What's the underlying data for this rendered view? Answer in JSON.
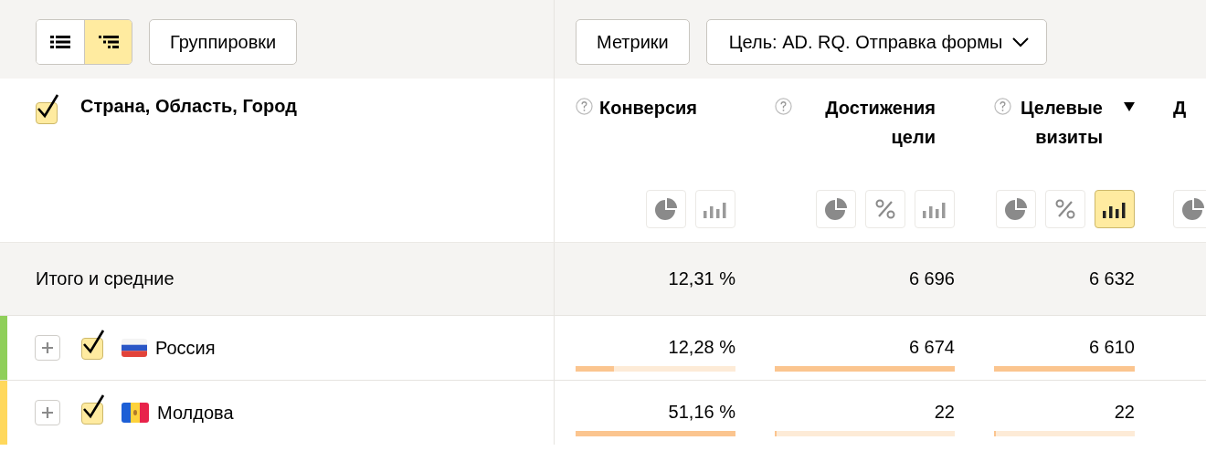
{
  "toolbar": {
    "view_modes": [
      {
        "kind": "list",
        "selected": false
      },
      {
        "kind": "tree",
        "selected": true
      }
    ],
    "groupings_button": "Группировки",
    "metrics_button": "Метрики",
    "goal_dropdown": "Цель: AD. RQ. Отправка формы"
  },
  "table": {
    "dimension_header": {
      "title": "Страна, Область, Город",
      "checked": true
    },
    "columns": [
      {
        "title": "Конверсия",
        "help": true,
        "sorted": false,
        "view_buttons": [
          {
            "kind": "pie",
            "selected": false
          },
          {
            "kind": "bars",
            "selected": false
          }
        ]
      },
      {
        "title": "Достижения цели",
        "help": true,
        "sorted": false,
        "view_buttons": [
          {
            "kind": "pie",
            "selected": false
          },
          {
            "kind": "percent",
            "selected": false
          },
          {
            "kind": "bars",
            "selected": false
          }
        ]
      },
      {
        "title": "Целевые визиты",
        "help": true,
        "sorted": true,
        "view_buttons": [
          {
            "kind": "pie",
            "selected": false
          },
          {
            "kind": "percent",
            "selected": false
          },
          {
            "kind": "bars",
            "selected": true
          }
        ]
      },
      {
        "title": "Д",
        "help": false,
        "sorted": false,
        "view_buttons": [
          {
            "kind": "pie",
            "selected": false
          }
        ]
      }
    ],
    "totals": {
      "label": "Итого и средние",
      "values": [
        "12,31 %",
        "6 696",
        "6 632"
      ]
    },
    "rows": [
      {
        "name": "Россия",
        "flag": {
          "kind": "ru"
        },
        "color": "#8fcf5a",
        "checked": true,
        "cells": [
          {
            "value": "12,28 %",
            "level": 0.24
          },
          {
            "value": "6 674",
            "level": 1
          },
          {
            "value": "6 610",
            "level": 1
          }
        ]
      },
      {
        "name": "Молдова",
        "flag": {
          "kind": "md"
        },
        "color": "#ffd85c",
        "checked": true,
        "cells": [
          {
            "value": "51,16 %",
            "level": 1
          },
          {
            "value": "22",
            "level": 0.01
          },
          {
            "value": "22",
            "level": 0.01
          }
        ]
      }
    ]
  }
}
